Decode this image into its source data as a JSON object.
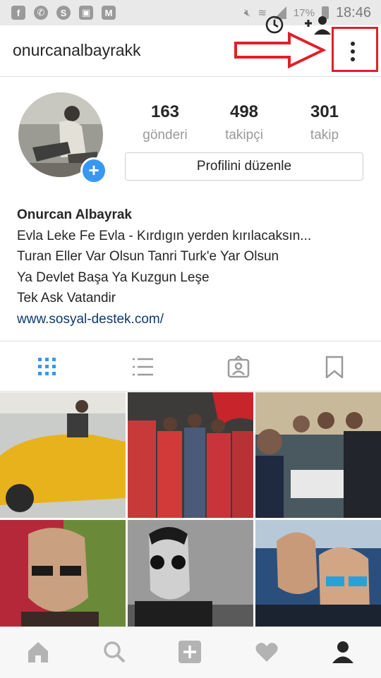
{
  "status_bar": {
    "battery": "17%",
    "time": "18:46",
    "icons": [
      "facebook-icon",
      "whatsapp-icon",
      "skype-icon",
      "image-icon",
      "gmail-icon",
      "mute-icon",
      "wifi-icon",
      "signal-icon",
      "battery-icon"
    ]
  },
  "header": {
    "username": "onurcanalbayrakk",
    "icons": [
      "history-icon",
      "add-person-icon",
      "more-options-icon"
    ]
  },
  "profile": {
    "stats": [
      {
        "count": "163",
        "label": "gönderi"
      },
      {
        "count": "498",
        "label": "takipçi"
      },
      {
        "count": "301",
        "label": "takip"
      }
    ],
    "edit_button_label": "Profilini düzenle",
    "full_name": "Onurcan Albayrak",
    "bio_lines": [
      "Evla Leke Fe Evla - Kırdıgın yerden kırılacaksın...",
      "Turan Eller Var Olsun Tanri Turk'e Yar Olsun",
      "Ya Devlet Başa Ya Kuzgun Leşe",
      "Tek Ask Vatandir"
    ],
    "website": "www.sosyal-destek.com/"
  },
  "view_tabs": [
    "grid-icon",
    "list-icon",
    "tagged-photos-icon",
    "saved-bookmark-icon"
  ],
  "grid_posts": [
    {
      "color": "#e8b21c"
    },
    {
      "color": "#6d5a55"
    },
    {
      "color": "#5b6a72"
    },
    {
      "color": "#5d7a3a"
    },
    {
      "color": "#8a8a8a"
    },
    {
      "color": "#2b4f7c"
    }
  ],
  "bottom_nav": [
    "home-icon",
    "search-icon",
    "new-post-icon",
    "activity-heart-icon",
    "profile-icon"
  ],
  "colors": {
    "accent": "#3897f0",
    "highlight_red": "#e0202a",
    "link": "#0e3a6e"
  }
}
